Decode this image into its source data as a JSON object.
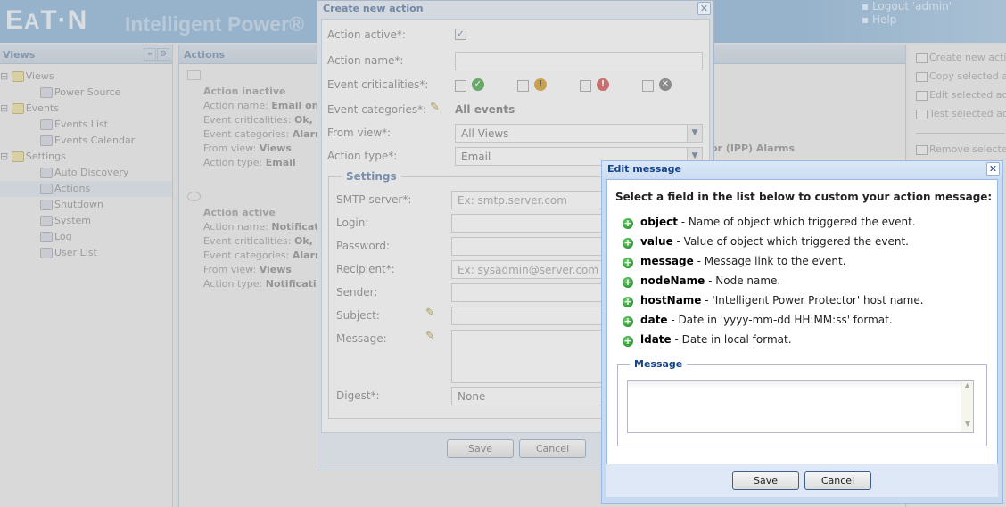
{
  "header": {
    "logo": "E·T·N",
    "app_title": "Intelligent Power®",
    "links": [
      "Logout 'admin'",
      "Help"
    ]
  },
  "left_panel": {
    "title": "Views",
    "tree": [
      {
        "label": "Views",
        "icon": "folder-icon",
        "level": 0
      },
      {
        "label": "Power Source",
        "icon": "power-source-icon",
        "level": 1
      },
      {
        "label": "Events",
        "icon": "folder-icon",
        "level": 0
      },
      {
        "label": "Events List",
        "icon": "events-list-icon",
        "level": 1
      },
      {
        "label": "Events Calendar",
        "icon": "calendar-icon",
        "level": 1
      },
      {
        "label": "Settings",
        "icon": "folder-icon",
        "level": 0
      },
      {
        "label": "Auto Discovery",
        "icon": "discovery-icon",
        "level": 1
      },
      {
        "label": "Actions",
        "icon": "actions-icon",
        "level": 1,
        "selected": true
      },
      {
        "label": "Shutdown",
        "icon": "shutdown-icon",
        "level": 1
      },
      {
        "label": "System",
        "icon": "gear-icon",
        "level": 1
      },
      {
        "label": "Log",
        "icon": "log-icon",
        "level": 1
      },
      {
        "label": "User List",
        "icon": "users-icon",
        "level": 1
      }
    ]
  },
  "main": {
    "title": "Actions",
    "actions": [
      {
        "status": "Action inactive",
        "name_label": "Action name:",
        "name": "Email on sh",
        "crit_label": "Event criticalities:",
        "crit": "Ok, War",
        "cat_label": "Event categories:",
        "cat": "Alarms",
        "view_label": "From view:",
        "view": "Views",
        "type_label": "Action type:",
        "type": "Email"
      },
      {
        "status": "Action active",
        "name_label": "Action name:",
        "name": "Notification",
        "crit_label": "Event criticalities:",
        "crit": "Ok, War",
        "cat_label": "Event categories:",
        "cat": "Alarms",
        "view_label": "From view:",
        "view": "Views",
        "type_label": "Action type:",
        "type": "Notification"
      }
    ],
    "partial_text": "or (IPP) Alarms"
  },
  "right_panel": {
    "items": [
      "Create new action",
      "Copy selected act",
      "Edit selected actio",
      "Test selected acti",
      "Remove selected"
    ]
  },
  "create_dialog": {
    "title": "Create new action",
    "action_active_label": "Action active*:",
    "action_active": true,
    "action_name_label": "Action name*:",
    "action_name": "",
    "criticalities_label": "Event criticalities*:",
    "categories_label": "Event categories*:",
    "categories_value": "All events",
    "from_view_label": "From view*:",
    "from_view": "All Views",
    "action_type_label": "Action type*:",
    "action_type": "Email",
    "settings_legend": "Settings",
    "smtp_label": "SMTP server*:",
    "smtp_placeholder": "Ex: smtp.server.com",
    "login_label": "Login:",
    "password_label": "Password:",
    "recipient_label": "Recipient*:",
    "recipient_placeholder": "Ex: sysadmin@server.com",
    "sender_label": "Sender:",
    "subject_label": "Subject:",
    "message_label": "Message:",
    "digest_label": "Digest*:",
    "digest": "None",
    "save": "Save",
    "cancel": "Cancel"
  },
  "edit_dialog": {
    "title": "Edit message",
    "instruction": "Select a field in the list below to custom your action message:",
    "fields": [
      {
        "name": "object",
        "desc": " - Name of object which triggered the event."
      },
      {
        "name": "value",
        "desc": " - Value of object which triggered the event."
      },
      {
        "name": "message",
        "desc": " - Message link to the event."
      },
      {
        "name": "nodeName",
        "desc": " - Node name."
      },
      {
        "name": "hostName",
        "desc": " - 'Intelligent Power Protector' host name."
      },
      {
        "name": "date",
        "desc": " - Date in 'yyyy-mm-dd HH:MM:ss' format."
      },
      {
        "name": "ldate",
        "desc": " - Date in local format."
      }
    ],
    "message_legend": "Message",
    "message_value": "",
    "save": "Save",
    "cancel": "Cancel"
  },
  "colors": {
    "header": "#97b3cb",
    "dialog_title": "#15428b",
    "ok": "#3aa33a",
    "warning": "#e0a020",
    "critical": "#d04040",
    "unknown": "#888888"
  }
}
